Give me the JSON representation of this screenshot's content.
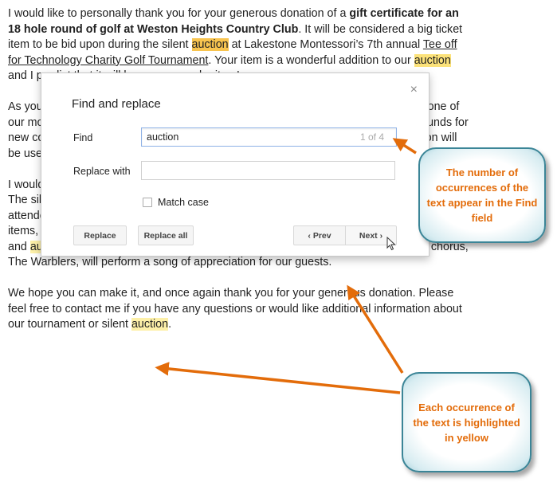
{
  "document": {
    "search_term": "auction",
    "paragraphs": [
      {
        "pre": "I would like to personally thank you for your generous donation of a ",
        "bold": "gift certificate for an 18 hole round of golf at Weston Heights Country Club",
        "mid": ". It will be considered a big ticket item to be bid upon during the silent ",
        "hl": "auction",
        "mid2": " at Lakestone Montessori’s 7th annual ",
        "link": "Tee off for Technology Charity Golf Tournament",
        "mid3": ". Your item is a wonderful addition to our ",
        "hl2": "auction",
        "post": " and I predict that it will be a very popular item!"
      },
      {
        "text": "As you may know, the Tee off for Technology Charity Golf Tournament fundraiser is one of our most important events of the year. We hope to reach this year’s goal of raising funds for new computers for the students at Lakestone. Funds raised through the silent auction will be used to purchase new technology so our students can continue their lessons."
      },
      {
        "text": "I would like to invite you to join us at the tournament on June 11, 2011, starting at 8 a.m. The silent auction bidding will take place throughout the day, and following the course, all attendees are invited to",
        "pre2": "dinner, in which participants will place their final silent bids for items, and then recognition of our generous donors and announcement of the tournament and ",
        "hl": "auction",
        "post": " winners will take place during the meal. At the close of the evening, our chorus, The Warblers, will perform a song of appreciation for our guests."
      },
      {
        "pre": "We hope you can make it, and once again thank you for your generous donation. Please feel free to contact me if you have any questions or would like additional information about our tournament or silent ",
        "hl": "auction",
        "post": "."
      }
    ]
  },
  "dialog": {
    "title": "Find and replace",
    "close_icon": "×",
    "find_label": "Find",
    "find_value": "auction",
    "match_count": "1 of 4",
    "replace_label": "Replace with",
    "replace_value": "",
    "match_case_label": "Match case",
    "match_case_checked": false,
    "buttons": {
      "replace": "Replace",
      "replace_all": "Replace all",
      "prev": "‹  Prev",
      "next": "Next  ›"
    }
  },
  "callouts": {
    "count": "The number of occurrences of the text appear in the Find field",
    "highlight": "Each occurrence of the text is highlighted in yellow"
  },
  "colors": {
    "highlight": "#fce27a",
    "current_highlight": "#f8c44f",
    "callout_text": "#e36c0a",
    "callout_border": "#3b8597",
    "arrow": "#e36c0a",
    "find_focus_border": "#8fb2e6"
  }
}
